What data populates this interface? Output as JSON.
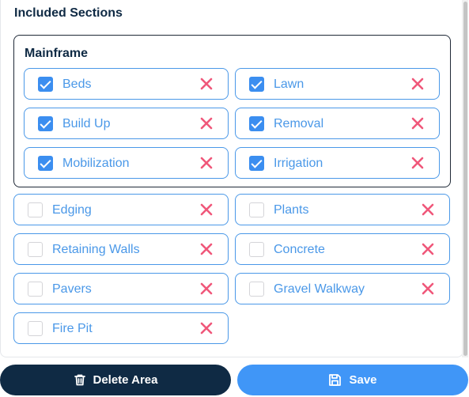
{
  "section_title": "Included Sections",
  "group": {
    "title": "Mainframe",
    "items": [
      {
        "label": "Beds",
        "checked": true
      },
      {
        "label": "Lawn",
        "checked": true
      },
      {
        "label": "Build Up",
        "checked": true
      },
      {
        "label": "Removal",
        "checked": true
      },
      {
        "label": "Mobilization",
        "checked": true
      },
      {
        "label": "Irrigation",
        "checked": true
      }
    ]
  },
  "items": [
    {
      "label": "Edging",
      "checked": false
    },
    {
      "label": "Plants",
      "checked": false
    },
    {
      "label": "Retaining Walls",
      "checked": false
    },
    {
      "label": "Concrete",
      "checked": false
    },
    {
      "label": "Pavers",
      "checked": false
    },
    {
      "label": "Gravel Walkway",
      "checked": false
    },
    {
      "label": "Fire Pit",
      "checked": false
    }
  ],
  "buttons": {
    "delete_label": "Delete Area",
    "save_label": "Save"
  },
  "icons": {
    "remove": "x-icon",
    "delete": "trash-icon",
    "save": "save-icon"
  },
  "colors": {
    "accent": "#4a98e8",
    "remove_x": "#f0577a",
    "primary_dark": "#0f2a44",
    "save_blue": "#4096f7"
  }
}
